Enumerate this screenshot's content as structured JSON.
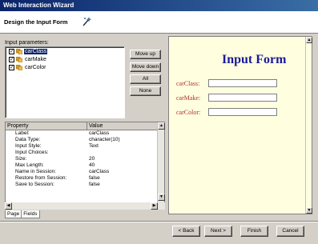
{
  "window": {
    "title": "Web Interaction Wizard"
  },
  "header": {
    "title": "Design the Input Form"
  },
  "params": {
    "label": "Input parameters:",
    "items": [
      {
        "label": "carClass",
        "checked": true,
        "selected": true
      },
      {
        "label": "carMake",
        "checked": true,
        "selected": false
      },
      {
        "label": "carColor",
        "checked": true,
        "selected": false
      }
    ]
  },
  "buttons": {
    "move_up": "Move up",
    "move_down": "Move down",
    "all": "All",
    "none": "None"
  },
  "properties": {
    "col_property": "Property",
    "col_value": "Value",
    "rows": [
      {
        "property": "Label:",
        "value": "carClass"
      },
      {
        "property": "Data Type:",
        "value": "character(10)"
      },
      {
        "property": "Input Style:",
        "value": "Text"
      },
      {
        "property": "Input Choices:",
        "value": ""
      },
      {
        "property": "Size:",
        "value": "20"
      },
      {
        "property": "Max Length:",
        "value": "40"
      },
      {
        "property": "Name in Session:",
        "value": "carClass"
      },
      {
        "property": "Restore from Session:",
        "value": "false"
      },
      {
        "property": "Save to Session:",
        "value": "false"
      }
    ]
  },
  "tabs": [
    {
      "label": "Page"
    },
    {
      "label": "Fields"
    }
  ],
  "preview": {
    "title": "Input Form",
    "fields": [
      {
        "label": "carClass:"
      },
      {
        "label": "carMake:"
      },
      {
        "label": "carColor:"
      }
    ]
  },
  "footer": {
    "back": "< Back",
    "next": "Next >",
    "finish": "Finish",
    "cancel": "Cancel"
  }
}
